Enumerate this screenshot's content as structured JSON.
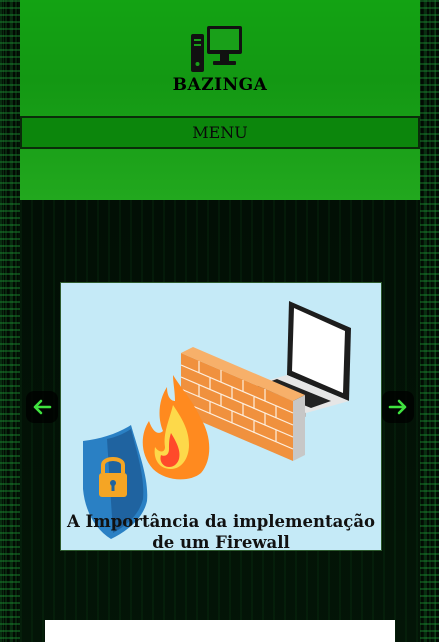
{
  "site": {
    "title": "BAZINGA",
    "logo_icon": "desktop-computer-icon"
  },
  "nav": {
    "menu_label": "MENU"
  },
  "carousel": {
    "slide": {
      "caption": "A Importância da implementação de um Firewall",
      "image_icons": [
        "laptop-icon",
        "brick-wall-icon",
        "fire-icon",
        "shield-lock-icon"
      ]
    },
    "prev_icon": "arrow-left-icon",
    "next_icon": "arrow-right-icon"
  },
  "colors": {
    "header_green": "#139813",
    "menu_green": "#0c860c",
    "arrow_green": "#3fe23f",
    "slide_bg": "#c5eaf7"
  }
}
